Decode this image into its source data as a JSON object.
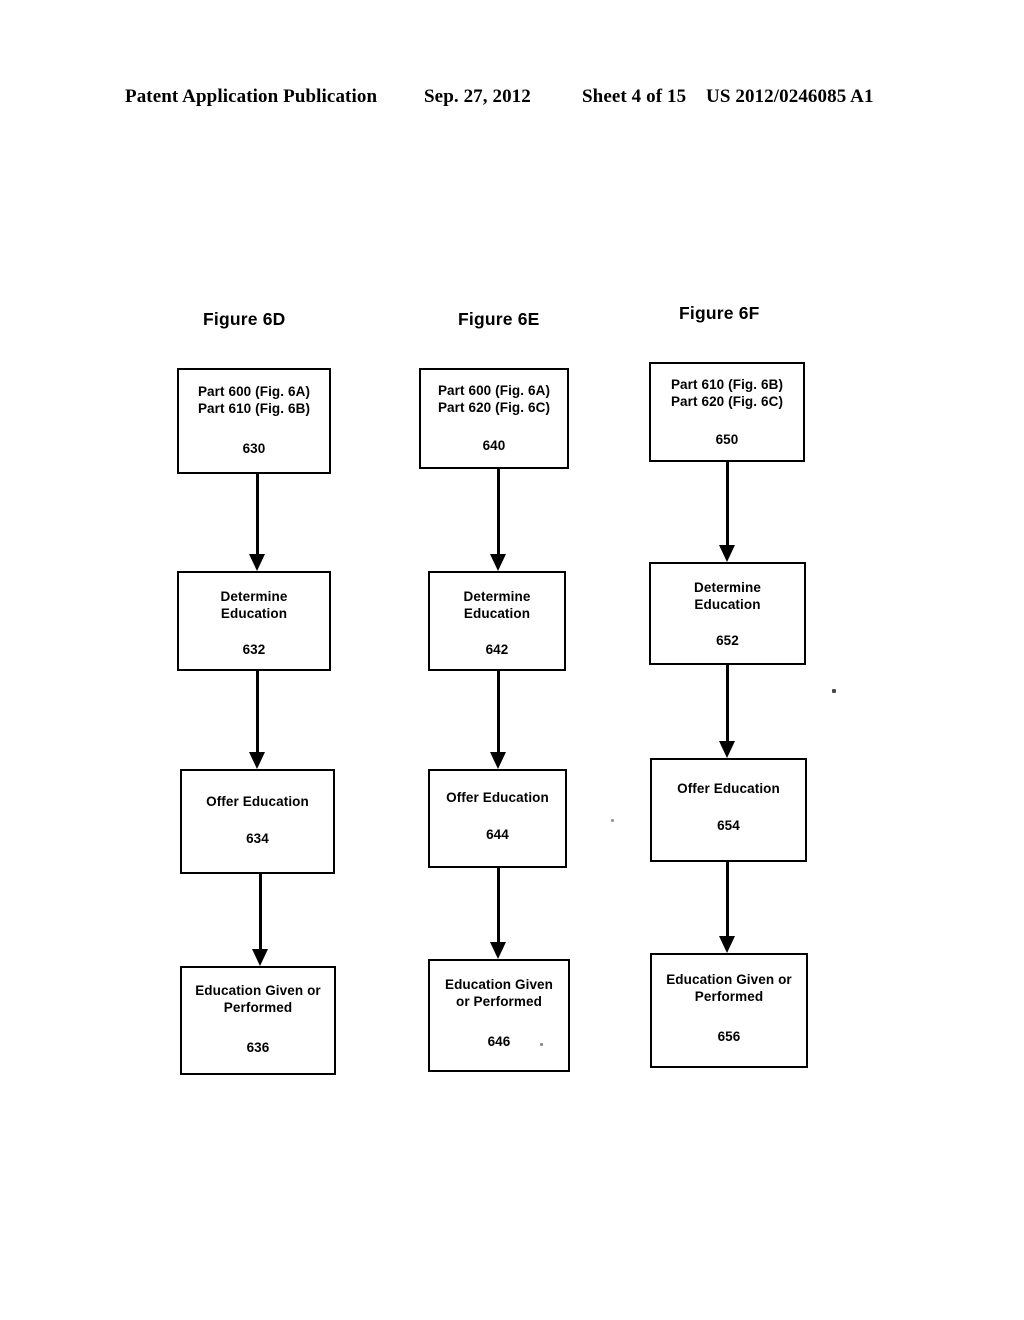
{
  "header": {
    "publication": "Patent Application Publication",
    "date": "Sep. 27, 2012",
    "sheet": "Sheet 4 of 15",
    "patent_number": "US 2012/0246085 A1"
  },
  "figures": [
    {
      "title": "Figure 6D",
      "boxes": [
        {
          "text": "Part 600 (Fig. 6A)\nPart 610 (Fig. 6B)",
          "ref": "630"
        },
        {
          "text": "Determine\nEducation",
          "ref": "632"
        },
        {
          "text": "Offer Education",
          "ref": "634"
        },
        {
          "text": "Education Given or\nPerformed",
          "ref": "636"
        }
      ]
    },
    {
      "title": "Figure 6E",
      "boxes": [
        {
          "text": "Part 600 (Fig. 6A)\nPart 620 (Fig. 6C)",
          "ref": "640"
        },
        {
          "text": "Determine\nEducation",
          "ref": "642"
        },
        {
          "text": "Offer Education",
          "ref": "644"
        },
        {
          "text": "Education Given\nor Performed",
          "ref": "646"
        }
      ]
    },
    {
      "title": "Figure 6F",
      "boxes": [
        {
          "text": "Part 610 (Fig. 6B)\nPart 620 (Fig. 6C)",
          "ref": "650"
        },
        {
          "text": "Determine\nEducation",
          "ref": "652"
        },
        {
          "text": "Offer Education",
          "ref": "654"
        },
        {
          "text": "Education Given or\nPerformed",
          "ref": "656"
        }
      ]
    }
  ],
  "colors": {
    "ink": "#000000",
    "page": "#ffffff"
  }
}
